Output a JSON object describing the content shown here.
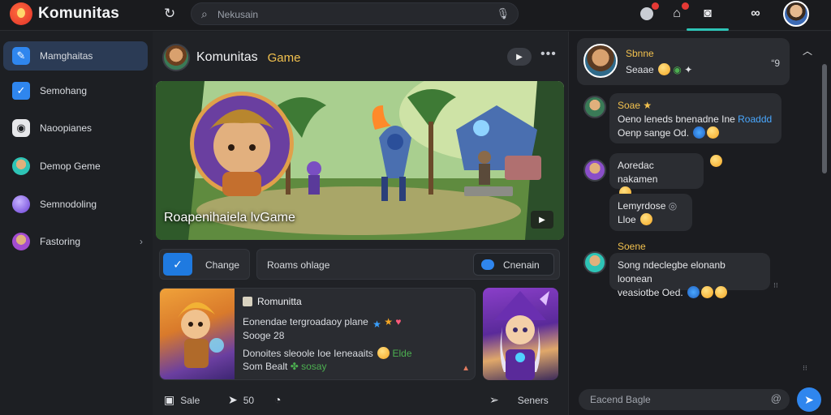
{
  "app": {
    "name": "Komunitas"
  },
  "search": {
    "placeholder": "Nekusain"
  },
  "sidebar": {
    "items": [
      {
        "label": "Mamghaitas",
        "icon": "brush-icon",
        "color": "#2f86ee"
      },
      {
        "label": "Semohang",
        "icon": "checkbox-icon",
        "color": "#2f86ee"
      },
      {
        "label": "Naoopianes",
        "icon": "camera-icon",
        "color": "#e6e7ea"
      },
      {
        "label": "Demop Geme",
        "icon": "game-avatar-icon",
        "color": "#2ec4b6"
      },
      {
        "label": "Semnodoling",
        "icon": "orb-icon",
        "color": "#8a5cf6"
      },
      {
        "label": "Fastoring",
        "icon": "character-avatar-icon",
        "color": "#a24cd0"
      }
    ],
    "chevron": "›"
  },
  "community": {
    "name": "Komunitas",
    "tag": "Game",
    "more": "•••"
  },
  "banner": {
    "title": "Roapenihaiela lvGame"
  },
  "actions": {
    "change_label": "Change",
    "middle_label": "Roams ohlage",
    "pill_label": "Cnenain"
  },
  "post": {
    "author": "Romunitta",
    "line1": "Eonendae tergroadaoy plane",
    "line2": "Sooge 28",
    "line3": "Donoites sleoole Ioe Ieneaaits",
    "line3_tail": "Elde",
    "line4_a": "Som Bealt",
    "line4_b": "sosay"
  },
  "footer": {
    "items": [
      {
        "icon": "bookmark-icon",
        "label": "Sale"
      },
      {
        "icon": "share-icon",
        "label": "50"
      },
      {
        "icon": "comment-icon",
        "label": ""
      },
      {
        "icon": "send-icon",
        "label": "Seners"
      }
    ]
  },
  "chat": {
    "pinned": {
      "name": "Sbnne",
      "sub": "Seaae",
      "quote": "“9"
    },
    "messages": [
      {
        "name": "Soae",
        "line1": "Oeno leneds bnenadne Ine",
        "line1_hl": "Roaddd",
        "line2": "Oenp sange Od."
      },
      {
        "name": "",
        "line1": "Aoredac nakamen",
        "line2": ""
      },
      {
        "name": "",
        "line1": "Lemyrdose",
        "line2": "Lloe"
      },
      {
        "name": "Soene",
        "line1": "Song ndeclegbe elonanb loonean",
        "line2": "veasiotbe Oed."
      }
    ],
    "compose_placeholder": "Eacend Bagle",
    "at": "@"
  }
}
